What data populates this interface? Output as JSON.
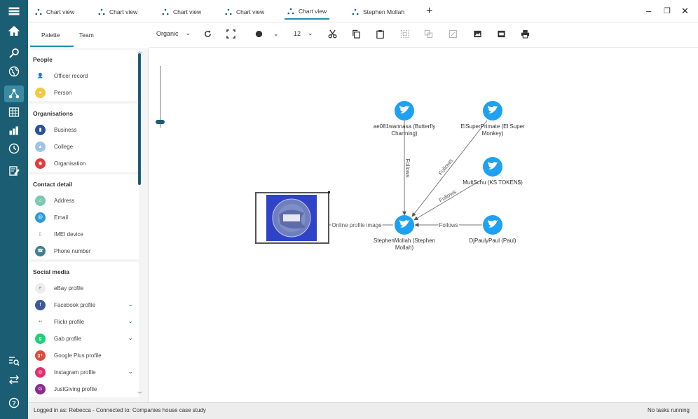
{
  "tabs": [
    {
      "label": "Chart view"
    },
    {
      "label": "Chart view"
    },
    {
      "label": "Chart view"
    },
    {
      "label": "Chart view"
    },
    {
      "label": "Chart view"
    },
    {
      "label": "Stephen Mollah"
    }
  ],
  "palette": {
    "tab_palette": "Palette",
    "tab_team": "Team",
    "sections": [
      {
        "title": "People",
        "items": [
          {
            "label": "Officer record",
            "color": "#ffffff",
            "glyph": "👤"
          },
          {
            "label": "Person",
            "color": "#f5c842",
            "glyph": "●"
          }
        ]
      },
      {
        "title": "Organisations",
        "items": [
          {
            "label": "Business",
            "color": "#2a4f9e",
            "glyph": "▮"
          },
          {
            "label": "College",
            "color": "#9fc3e8",
            "glyph": "▲"
          },
          {
            "label": "Organisation",
            "color": "#e03a3a",
            "glyph": "◉"
          }
        ]
      },
      {
        "title": "Contact detail",
        "items": [
          {
            "label": "Address",
            "color": "#7cc8b0",
            "glyph": "⌂"
          },
          {
            "label": "Email",
            "color": "#2a9bd6",
            "glyph": "@"
          },
          {
            "label": "IMEI device",
            "color": "#ffffff",
            "glyph": "▯"
          },
          {
            "label": "Phone number",
            "color": "#3e7f8f",
            "glyph": "☎"
          }
        ]
      },
      {
        "title": "Social media",
        "items": [
          {
            "label": "eBay profile",
            "color": "#eeeeee",
            "glyph": "e"
          },
          {
            "label": "Facebook profile",
            "color": "#3b5998",
            "glyph": "f",
            "chevron": true
          },
          {
            "label": "Flickr profile",
            "color": "#ffffff",
            "glyph": "••",
            "chevron": true
          },
          {
            "label": "Gab profile",
            "color": "#21cf7a",
            "glyph": "g",
            "chevron": true
          },
          {
            "label": "Google Plus profile",
            "color": "#dd4b39",
            "glyph": "g+"
          },
          {
            "label": "Instagram profile",
            "color": "#e1306c",
            "glyph": "◎",
            "chevron": true
          },
          {
            "label": "JustGiving profile",
            "color": "#8e2a8e",
            "glyph": "G"
          }
        ]
      }
    ]
  },
  "toolbar": {
    "layout": "Organic",
    "node_size": "12",
    "accent": "#1b5e73"
  },
  "graph": {
    "nodes": [
      {
        "id": "ae081",
        "label_line1": "ae081wannasa (Butterfly",
        "label_line2": "Charming)"
      },
      {
        "id": "elsuper",
        "label_line1": "ElSuperPrimate (El Super",
        "label_line2": "Monkey)"
      },
      {
        "id": "multschu",
        "label_line1": "MultSchu (KS TOKEN$)",
        "label_line2": ""
      },
      {
        "id": "stephen",
        "label_line1": "StephenMollah (Stephen",
        "label_line2": "Mollah)"
      },
      {
        "id": "djpauly",
        "label_line1": "DjPaulyPaul (Paul)",
        "label_line2": ""
      }
    ],
    "edges": [
      {
        "from": "ae081",
        "to": "stephen",
        "label": "Follows"
      },
      {
        "from": "elsuper",
        "to": "stephen",
        "label": "Follows"
      },
      {
        "from": "multschu",
        "to": "stephen",
        "label": "Follows"
      },
      {
        "from": "djpauly",
        "to": "stephen",
        "label": "Follows"
      },
      {
        "from": "stephen",
        "to": "image",
        "label": "Online profile image"
      }
    ],
    "node_color": "#1da1f2"
  },
  "status": {
    "left": "Logged in as: Rebecca - Connected to: Companies house case study",
    "right": "No tasks running"
  }
}
